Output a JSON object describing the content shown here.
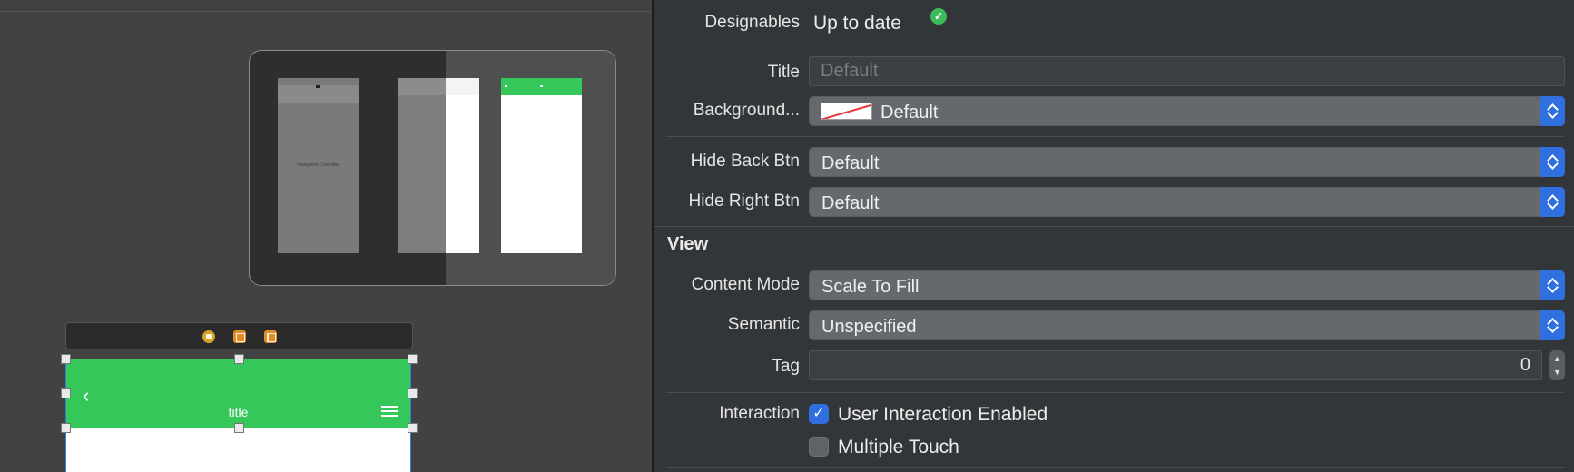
{
  "canvas": {
    "scene1_label": "Navigation Controller",
    "device": {
      "nav_title": "title"
    }
  },
  "inspector": {
    "designables": {
      "label": "Designables",
      "value": "Up to date",
      "status_icon": "check-circle-icon",
      "status_color": "#3dbb5c"
    },
    "title": {
      "label": "Title",
      "placeholder": "Default",
      "value": ""
    },
    "background": {
      "label": "Background...",
      "value": "Default"
    },
    "hide_back_btn": {
      "label": "Hide Back Btn",
      "value": "Default"
    },
    "hide_right_btn": {
      "label": "Hide Right Btn",
      "value": "Default"
    },
    "view_section": {
      "header": "View"
    },
    "content_mode": {
      "label": "Content Mode",
      "value": "Scale To Fill"
    },
    "semantic": {
      "label": "Semantic",
      "value": "Unspecified"
    },
    "tag": {
      "label": "Tag",
      "value": "0"
    },
    "interaction": {
      "label": "Interaction",
      "options": [
        {
          "label": "User Interaction Enabled",
          "checked": true
        },
        {
          "label": "Multiple Touch",
          "checked": false
        }
      ]
    }
  },
  "colors": {
    "accent": "#2f6fe0",
    "navbar_green": "#35c75a"
  }
}
